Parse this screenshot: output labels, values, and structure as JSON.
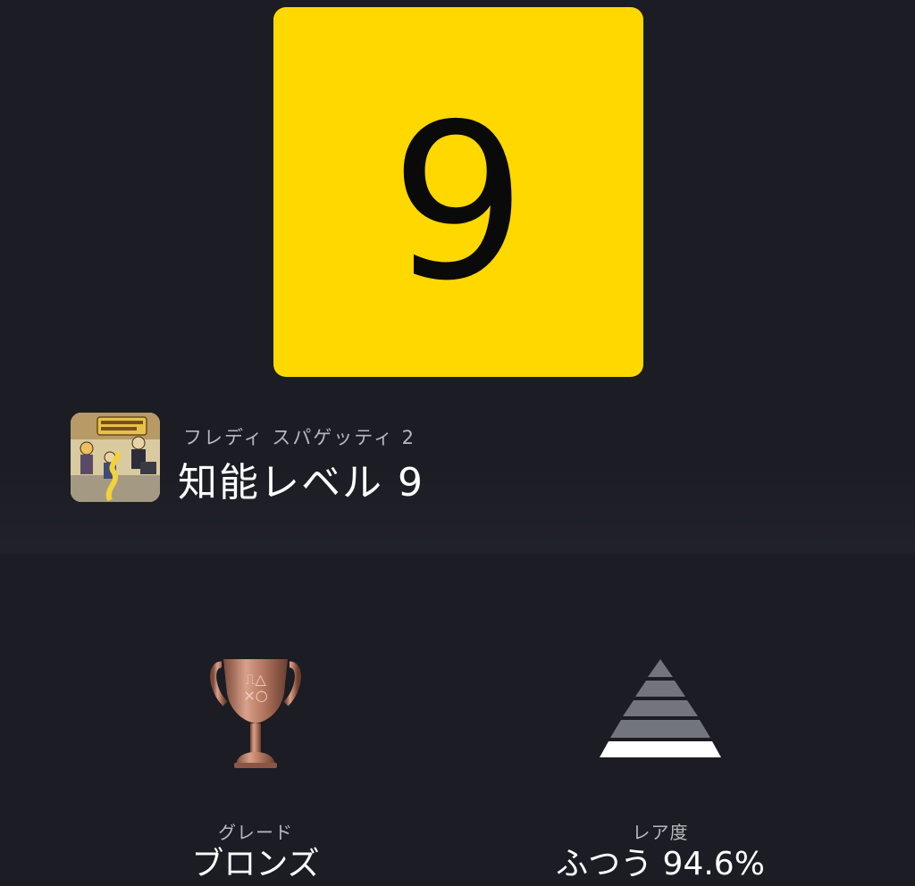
{
  "trophy": {
    "art_number": "9",
    "art_color": "#ffd800",
    "game_name": "フレディ スパゲッティ 2",
    "name": "知能レベル 9",
    "game_icon": "game-cover-art"
  },
  "grade": {
    "label": "グレード",
    "value": "ブロンズ",
    "icon": "bronze-trophy-icon",
    "icon_color": "#b77a63"
  },
  "rarity": {
    "label": "レア度",
    "value": "ふつう 94.6%",
    "icon": "rarity-pyramid-icon"
  }
}
